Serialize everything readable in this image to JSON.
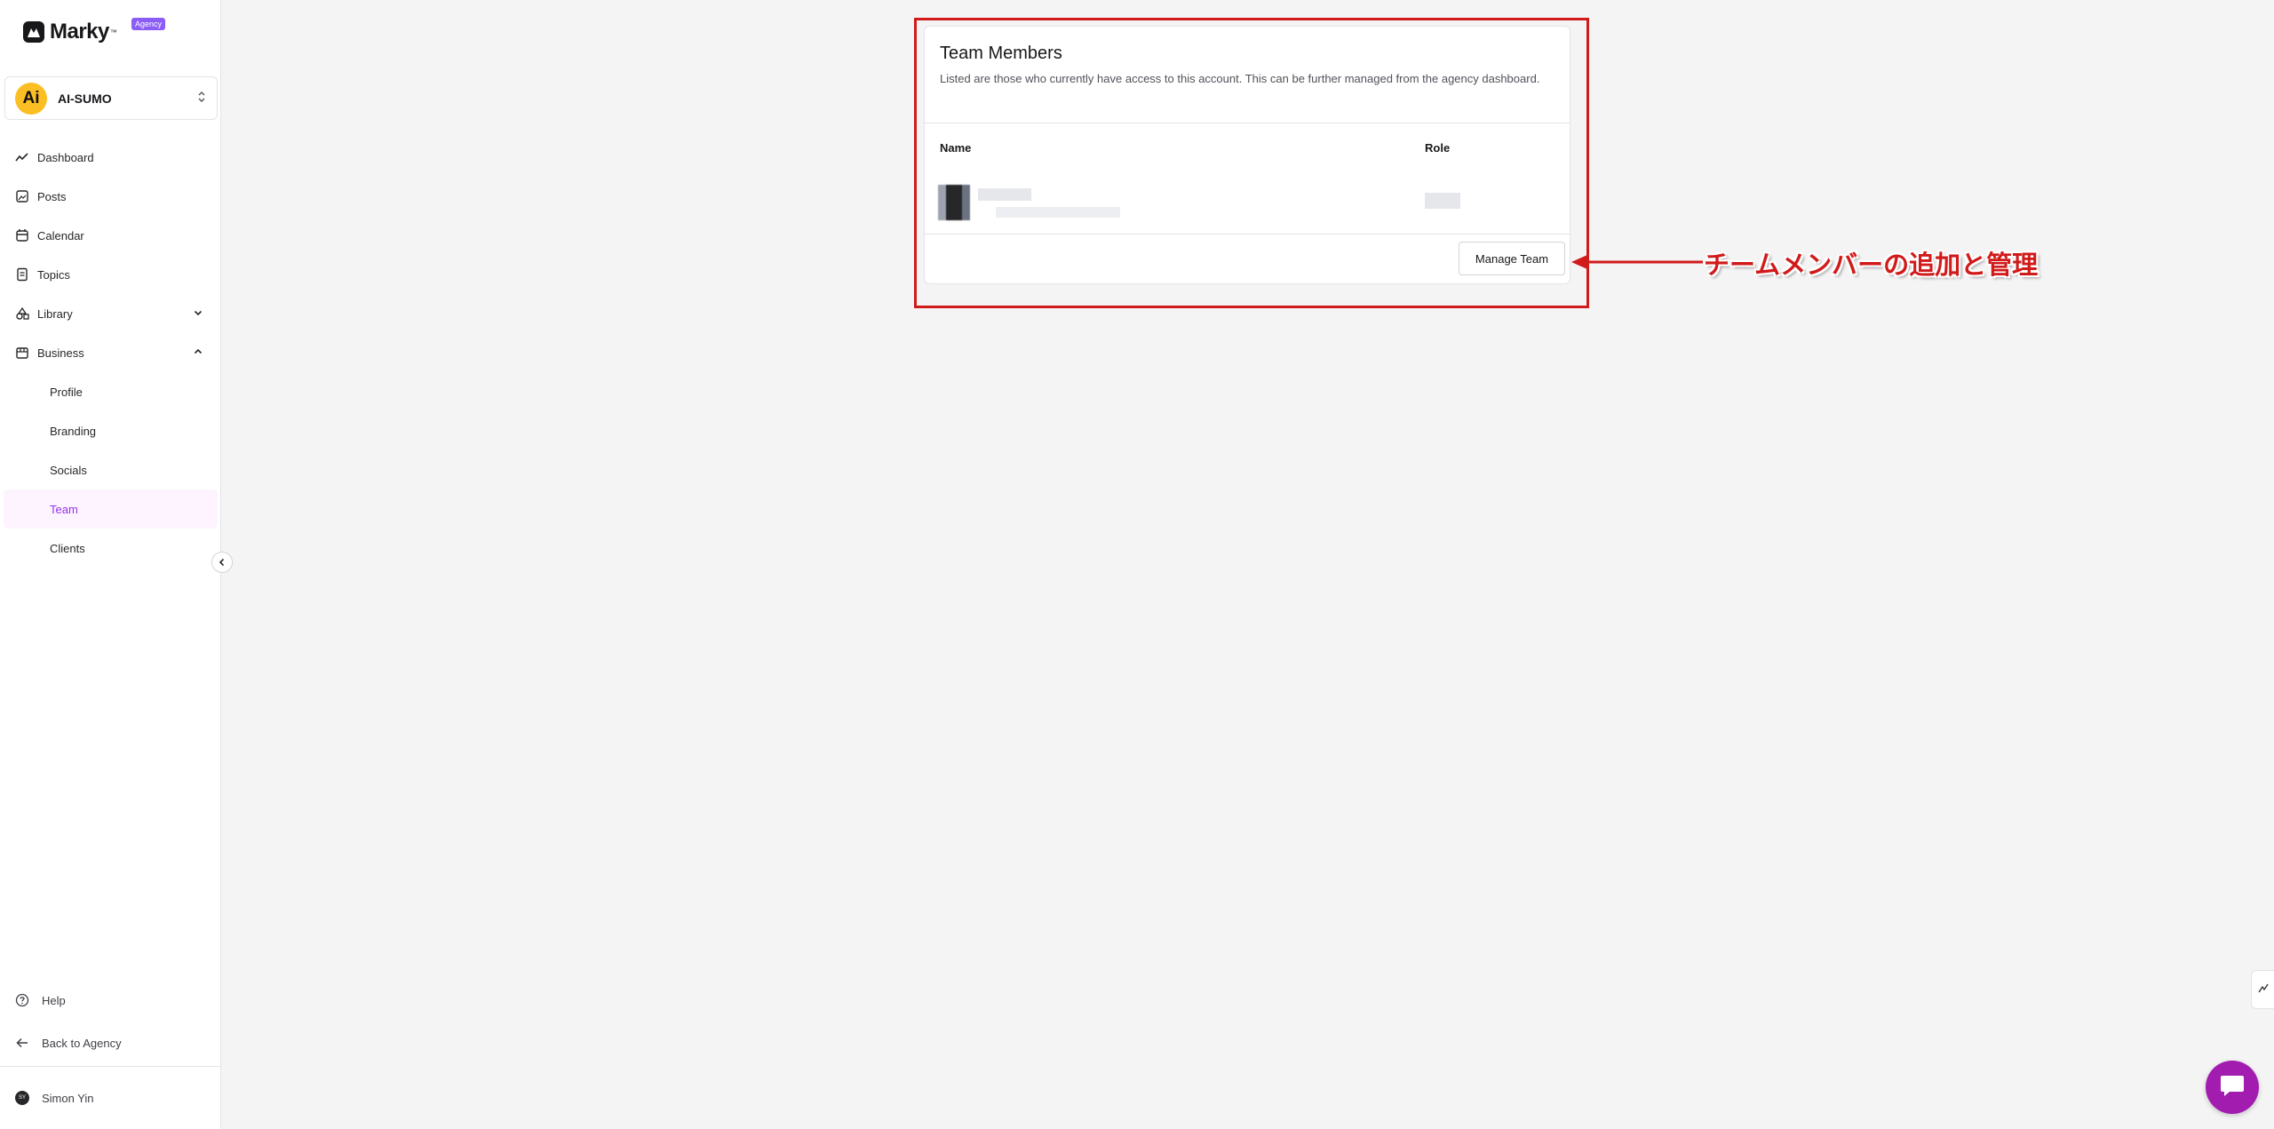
{
  "app": {
    "logo_text": "Marky",
    "logo_tm": "™",
    "badge": "Agency"
  },
  "account": {
    "avatar_text": "Ai",
    "name": "AI-SUMO"
  },
  "nav": {
    "dashboard": "Dashboard",
    "posts": "Posts",
    "calendar": "Calendar",
    "topics": "Topics",
    "library": "Library",
    "business": "Business",
    "sub": {
      "profile": "Profile",
      "branding": "Branding",
      "socials": "Socials",
      "team": "Team",
      "clients": "Clients"
    }
  },
  "bottom": {
    "help": "Help",
    "back": "Back to Agency",
    "user_initials": "SY",
    "user_name": "Simon Yin"
  },
  "card": {
    "title": "Team Members",
    "description": "Listed are those who currently have access to this account. This can be further managed from the agency dashboard.",
    "col_name": "Name",
    "col_role": "Role",
    "manage_button": "Manage Team"
  },
  "annotation": {
    "text": "チームメンバーの追加と管理"
  },
  "colors": {
    "accent": "#9333ea",
    "active_bg": "#fdf4ff",
    "annotation_red": "#d11a1a",
    "chat_button": "#a21caf"
  }
}
